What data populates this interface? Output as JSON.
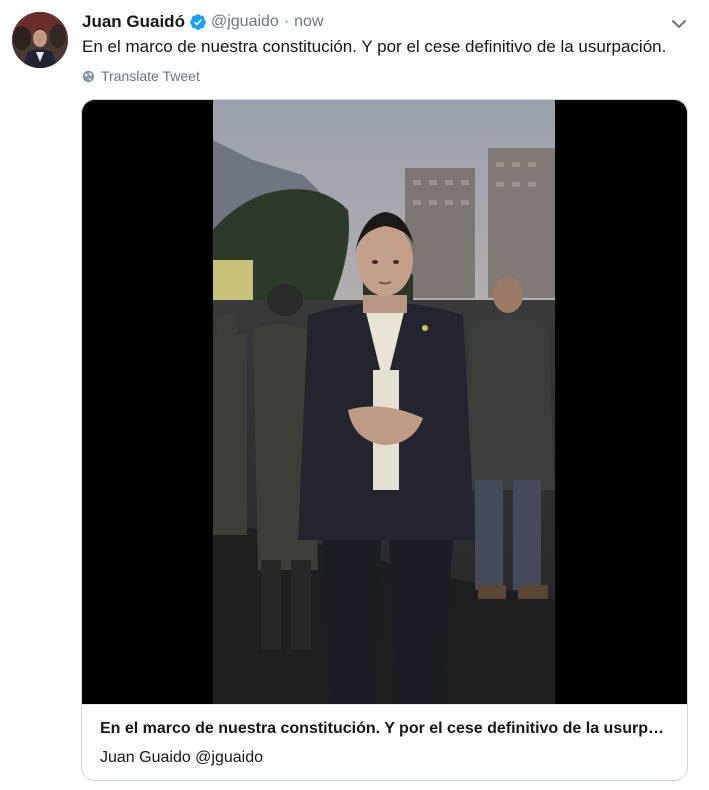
{
  "tweet": {
    "author": {
      "display_name": "Juan Guaidó",
      "handle": "@jguaido",
      "verified": true
    },
    "separator": "·",
    "timestamp": "now",
    "text": "En el marco de nuestra constitución. Y por el cese definitivo de la usurpación.",
    "translate_label": "Translate Tweet",
    "card": {
      "title": "En el marco de nuestra constitución. Y por el cese definitivo de la usurpación.",
      "source": "Juan Guaido @jguaido"
    }
  },
  "icons": {
    "verified": "verified-badge-icon",
    "caret": "chevron-down-icon",
    "translate": "globe-icon"
  },
  "colors": {
    "primary_text": "#14171a",
    "secondary_text": "#657786",
    "verified_blue": "#1da1f2",
    "card_border": "#ccd6dd"
  }
}
